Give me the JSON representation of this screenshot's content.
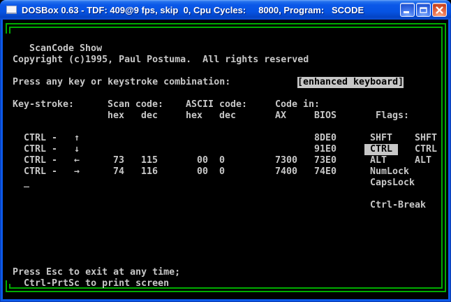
{
  "window": {
    "title": "DOSBox 0.63 - TDF: 409@9 fps, skip  0, Cpu Cycles:     8000, Program:   SCODE",
    "controls": [
      {
        "name": "minimize",
        "icon": "minimize-icon"
      },
      {
        "name": "maximize",
        "icon": "maximize-icon"
      },
      {
        "name": "close",
        "icon": "close-icon"
      }
    ]
  },
  "colors": {
    "titlebar_blue": "#0b58e8",
    "border_blue": "#0c59e8",
    "close_red": "#d6512d",
    "dos_text": "#c7c7c7",
    "dos_background": "#000000",
    "box_green": "#00ad00",
    "highlight_bg": "#c7c7c7"
  },
  "screen": {
    "rows": [
      {
        "row": 2,
        "name": "program-title-row",
        "segments": [
          {
            "col": 5,
            "text": "ScanCode Show",
            "name": "program-name"
          }
        ]
      },
      {
        "row": 3,
        "name": "copyright-row",
        "segments": [
          {
            "col": 2,
            "text": "Copyright (c)1995, Paul Postuma.  All rights reserved",
            "name": "copyright-text"
          }
        ]
      },
      {
        "row": 5,
        "name": "prompt-row",
        "segments": [
          {
            "col": 2,
            "text": "Press any key or keystroke combination:",
            "name": "prompt-text"
          },
          {
            "col": 53,
            "text": "[enhanced keyboard]",
            "hl": true,
            "name": "keyboard-mode-badge"
          }
        ]
      },
      {
        "row": 7,
        "name": "table-header-row",
        "segments": [
          {
            "col": 2,
            "text": "Key-stroke:",
            "name": "col-header-keystroke"
          },
          {
            "col": 19,
            "text": "Scan code:",
            "name": "col-header-scancode"
          },
          {
            "col": 33,
            "text": "ASCII code:",
            "name": "col-header-ascii"
          },
          {
            "col": 49,
            "text": "Code in:",
            "name": "col-header-codein"
          }
        ]
      },
      {
        "row": 8,
        "name": "table-subheader-row",
        "segments": [
          {
            "col": 19,
            "text": "hex",
            "name": "subheader-scan-hex"
          },
          {
            "col": 25,
            "text": "dec",
            "name": "subheader-scan-dec"
          },
          {
            "col": 33,
            "text": "hex",
            "name": "subheader-ascii-hex"
          },
          {
            "col": 39,
            "text": "dec",
            "name": "subheader-ascii-dec"
          },
          {
            "col": 49,
            "text": "AX",
            "name": "subheader-ax"
          },
          {
            "col": 56,
            "text": "BIOS",
            "name": "subheader-bios"
          },
          {
            "col": 67,
            "text": "Flags:",
            "name": "col-header-flags"
          }
        ]
      },
      {
        "row": 10,
        "name": "keystroke-row",
        "segments": [
          {
            "col": 4,
            "text": "CTRL",
            "name": "key-name"
          },
          {
            "col": 9,
            "text": "-",
            "name": "dash"
          },
          {
            "col": 13,
            "text": "↑",
            "name": "arrow-up-icon"
          },
          {
            "col": 56,
            "text": "8DE0",
            "name": "bios-value"
          },
          {
            "col": 66,
            "text": "SHFT",
            "name": "flag-shft-left"
          },
          {
            "col": 74,
            "text": "SHFT",
            "name": "flag-shft-right"
          }
        ]
      },
      {
        "row": 11,
        "name": "keystroke-row",
        "segments": [
          {
            "col": 4,
            "text": "CTRL",
            "name": "key-name"
          },
          {
            "col": 9,
            "text": "-",
            "name": "dash"
          },
          {
            "col": 13,
            "text": "↓",
            "name": "arrow-down-icon"
          },
          {
            "col": 56,
            "text": "91E0",
            "name": "bios-value"
          },
          {
            "col": 65,
            "text": " CTRL ",
            "hl": true,
            "name": "flag-ctrl-left-active"
          },
          {
            "col": 74,
            "text": "CTRL",
            "name": "flag-ctrl-right"
          }
        ]
      },
      {
        "row": 12,
        "name": "keystroke-row",
        "segments": [
          {
            "col": 4,
            "text": "CTRL",
            "name": "key-name"
          },
          {
            "col": 9,
            "text": "-",
            "name": "dash"
          },
          {
            "col": 13,
            "text": "←",
            "name": "arrow-left-icon"
          },
          {
            "col": 20,
            "text": "73",
            "name": "scan-hex"
          },
          {
            "col": 25,
            "text": "115",
            "name": "scan-dec"
          },
          {
            "col": 35,
            "text": "00",
            "name": "ascii-hex"
          },
          {
            "col": 39,
            "text": "0",
            "name": "ascii-dec"
          },
          {
            "col": 49,
            "text": "7300",
            "name": "ax-value"
          },
          {
            "col": 56,
            "text": "73E0",
            "name": "bios-value"
          },
          {
            "col": 66,
            "text": "ALT",
            "name": "flag-alt-left"
          },
          {
            "col": 74,
            "text": "ALT",
            "name": "flag-alt-right"
          }
        ]
      },
      {
        "row": 13,
        "name": "keystroke-row",
        "segments": [
          {
            "col": 4,
            "text": "CTRL",
            "name": "key-name"
          },
          {
            "col": 9,
            "text": "-",
            "name": "dash"
          },
          {
            "col": 13,
            "text": "→",
            "name": "arrow-right-icon"
          },
          {
            "col": 20,
            "text": "74",
            "name": "scan-hex"
          },
          {
            "col": 25,
            "text": "116",
            "name": "scan-dec"
          },
          {
            "col": 35,
            "text": "00",
            "name": "ascii-hex"
          },
          {
            "col": 39,
            "text": "0",
            "name": "ascii-dec"
          },
          {
            "col": 49,
            "text": "7400",
            "name": "ax-value"
          },
          {
            "col": 56,
            "text": "74E0",
            "name": "bios-value"
          },
          {
            "col": 66,
            "text": "NumLock",
            "name": "flag-numlock"
          }
        ]
      },
      {
        "row": 14,
        "name": "cursor-row",
        "segments": [
          {
            "col": 4,
            "text": "_",
            "name": "text-cursor"
          },
          {
            "col": 66,
            "text": "CapsLock",
            "name": "flag-capslock"
          }
        ]
      },
      {
        "row": 16,
        "name": "flag-row",
        "segments": [
          {
            "col": 66,
            "text": "Ctrl-Break",
            "name": "flag-ctrl-break"
          }
        ]
      },
      {
        "row": 22,
        "name": "hint-row",
        "segments": [
          {
            "col": 2,
            "text": "Press Esc to exit at any time;",
            "name": "exit-hint"
          }
        ]
      },
      {
        "row": 23,
        "name": "hint-row",
        "segments": [
          {
            "col": 4,
            "text": "Ctrl-PrtSc to print screen",
            "name": "print-hint"
          }
        ]
      }
    ]
  }
}
